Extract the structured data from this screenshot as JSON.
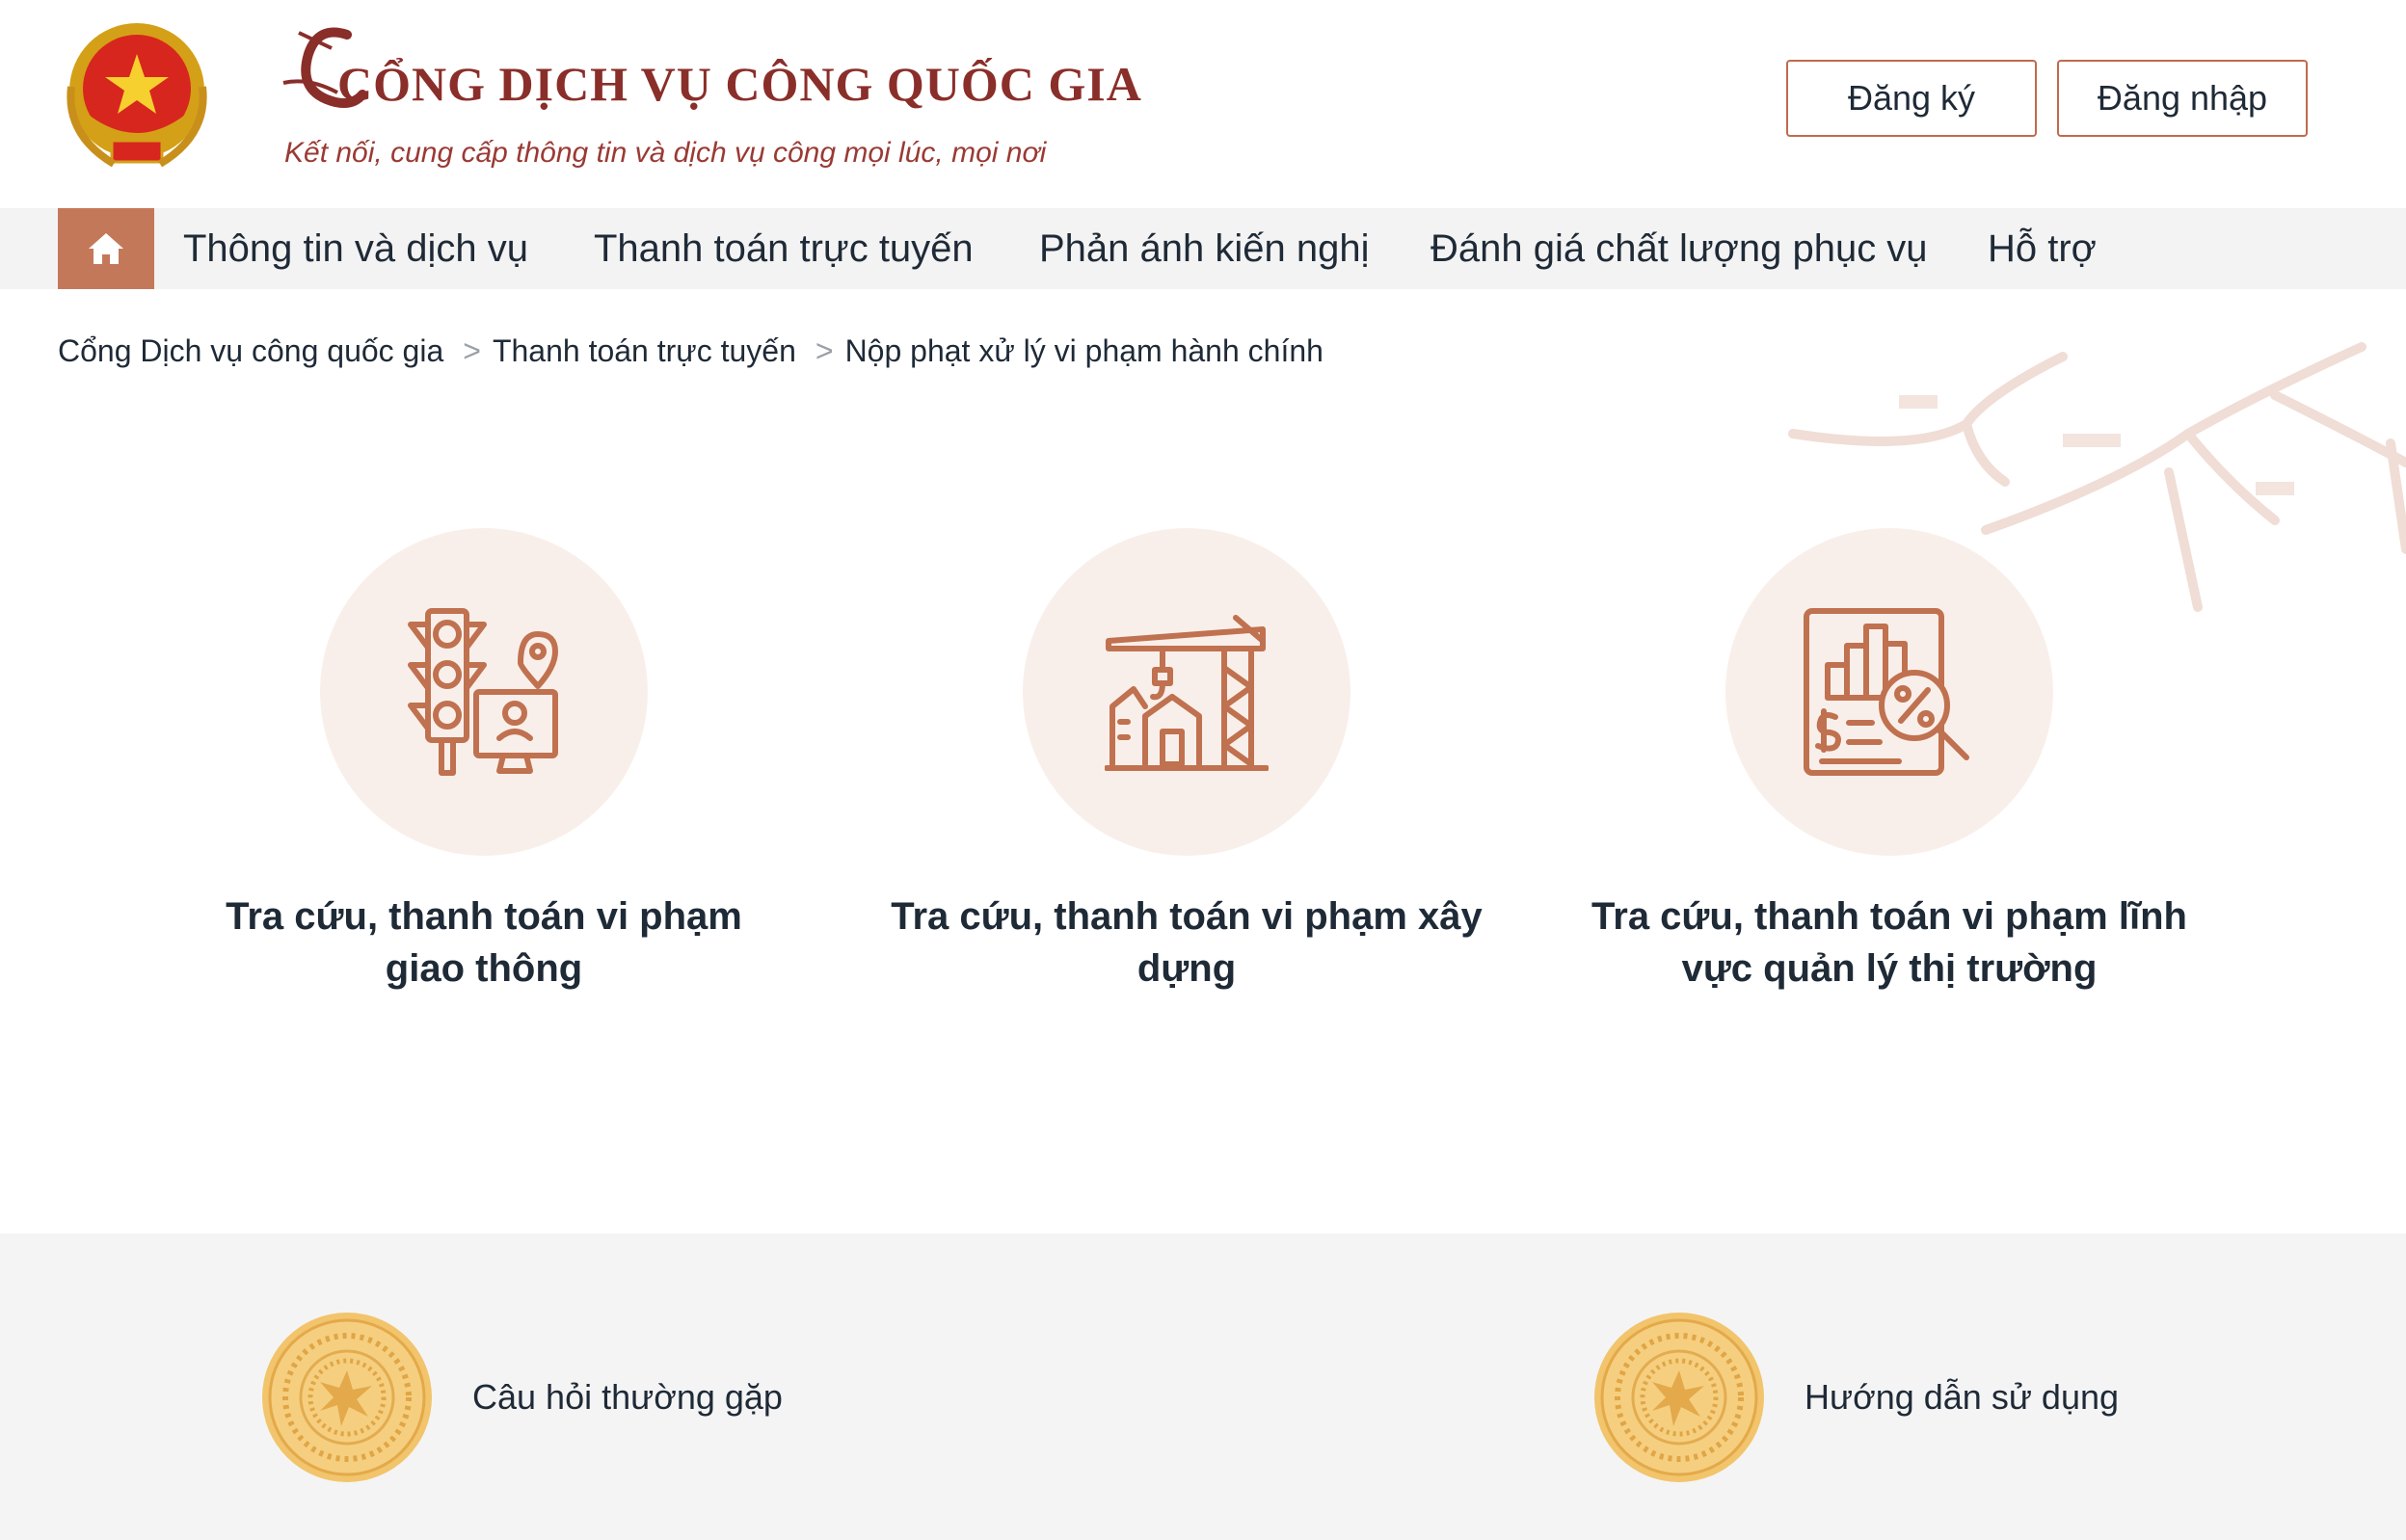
{
  "header": {
    "title": "CỔNG DỊCH VỤ CÔNG QUỐC GIA",
    "subtitle": "Kết nối, cung cấp thông tin và dịch vụ công mọi lúc, mọi nơi",
    "register_label": "Đăng ký",
    "login_label": "Đăng nhập"
  },
  "nav": {
    "items": [
      {
        "label": "Thông tin và dịch vụ"
      },
      {
        "label": "Thanh toán trực tuyến"
      },
      {
        "label": "Phản ánh kiến nghị"
      },
      {
        "label": "Đánh giá chất lượng phục vụ"
      },
      {
        "label": "Hỗ trợ"
      }
    ]
  },
  "breadcrumb": {
    "items": [
      "Cổng Dịch vụ công quốc gia",
      "Thanh toán trực tuyến",
      "Nộp phạt xử lý vi phạm hành chính"
    ],
    "separator": ">"
  },
  "services": [
    {
      "title": "Tra cứu, thanh toán vi phạm giao thông",
      "icon": "traffic-light-icon"
    },
    {
      "title": "Tra cứu, thanh toán vi phạm xây dựng",
      "icon": "construction-crane-icon"
    },
    {
      "title": "Tra cứu, thanh toán vi phạm lĩnh vực quản lý thị trường",
      "icon": "market-report-icon"
    }
  ],
  "help": {
    "faq_label": "Câu hỏi thường gặp",
    "guide_label": "Hướng dẫn sử dụng"
  },
  "colors": {
    "brand": "#8a2e2a",
    "accent": "#c4785a",
    "icon_stroke": "#c0714f",
    "icon_bg": "#f9efea",
    "nav_bg": "#f3f3f3",
    "footer_bg": "#f4f4f4"
  }
}
